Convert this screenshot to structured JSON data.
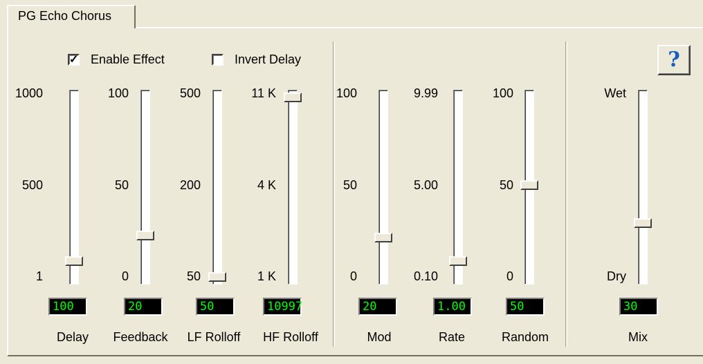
{
  "tab": {
    "label": "PG Echo Chorus"
  },
  "checkboxes": [
    {
      "label": "Enable Effect",
      "checked": true
    },
    {
      "label": "Invert Delay",
      "checked": false
    }
  ],
  "help": {
    "icon": "question-icon",
    "glyph": "?",
    "color": "#1560bd"
  },
  "sliders": [
    {
      "id": "delay",
      "ticks": [
        "1000",
        "500",
        "1"
      ],
      "value_text": "100",
      "label": "Delay",
      "position": 0.91
    },
    {
      "id": "feedback",
      "ticks": [
        "100",
        "50",
        "0"
      ],
      "value_text": "20",
      "label": "Feedback",
      "position": 0.77
    },
    {
      "id": "lf-rolloff",
      "ticks": [
        "500",
        "200",
        "50"
      ],
      "value_text": "50",
      "label": "LF Rolloff",
      "position": 1.0
    },
    {
      "id": "hf-rolloff",
      "ticks": [
        "11 K",
        "4 K",
        "1 K"
      ],
      "value_text": "10997",
      "label": "HF Rolloff",
      "position": 0.0
    },
    {
      "id": "mod",
      "ticks": [
        "100",
        "50",
        "0"
      ],
      "value_text": "20",
      "label": "Mod",
      "position": 0.78
    },
    {
      "id": "rate",
      "ticks": [
        "9.99",
        "5.00",
        "0.10"
      ],
      "value_text": "1.00",
      "label": "Rate",
      "position": 0.91
    },
    {
      "id": "random",
      "ticks": [
        "100",
        "50",
        "0"
      ],
      "value_text": "50",
      "label": "Random",
      "position": 0.49
    },
    {
      "id": "mix",
      "ticks": [
        "Wet",
        "",
        "Dry"
      ],
      "value_text": "30",
      "label": "Mix",
      "position": 0.7
    }
  ],
  "colors": {
    "lcd_bg": "#000000",
    "lcd_text": "#00ff00",
    "panel": "#ece9d8"
  }
}
